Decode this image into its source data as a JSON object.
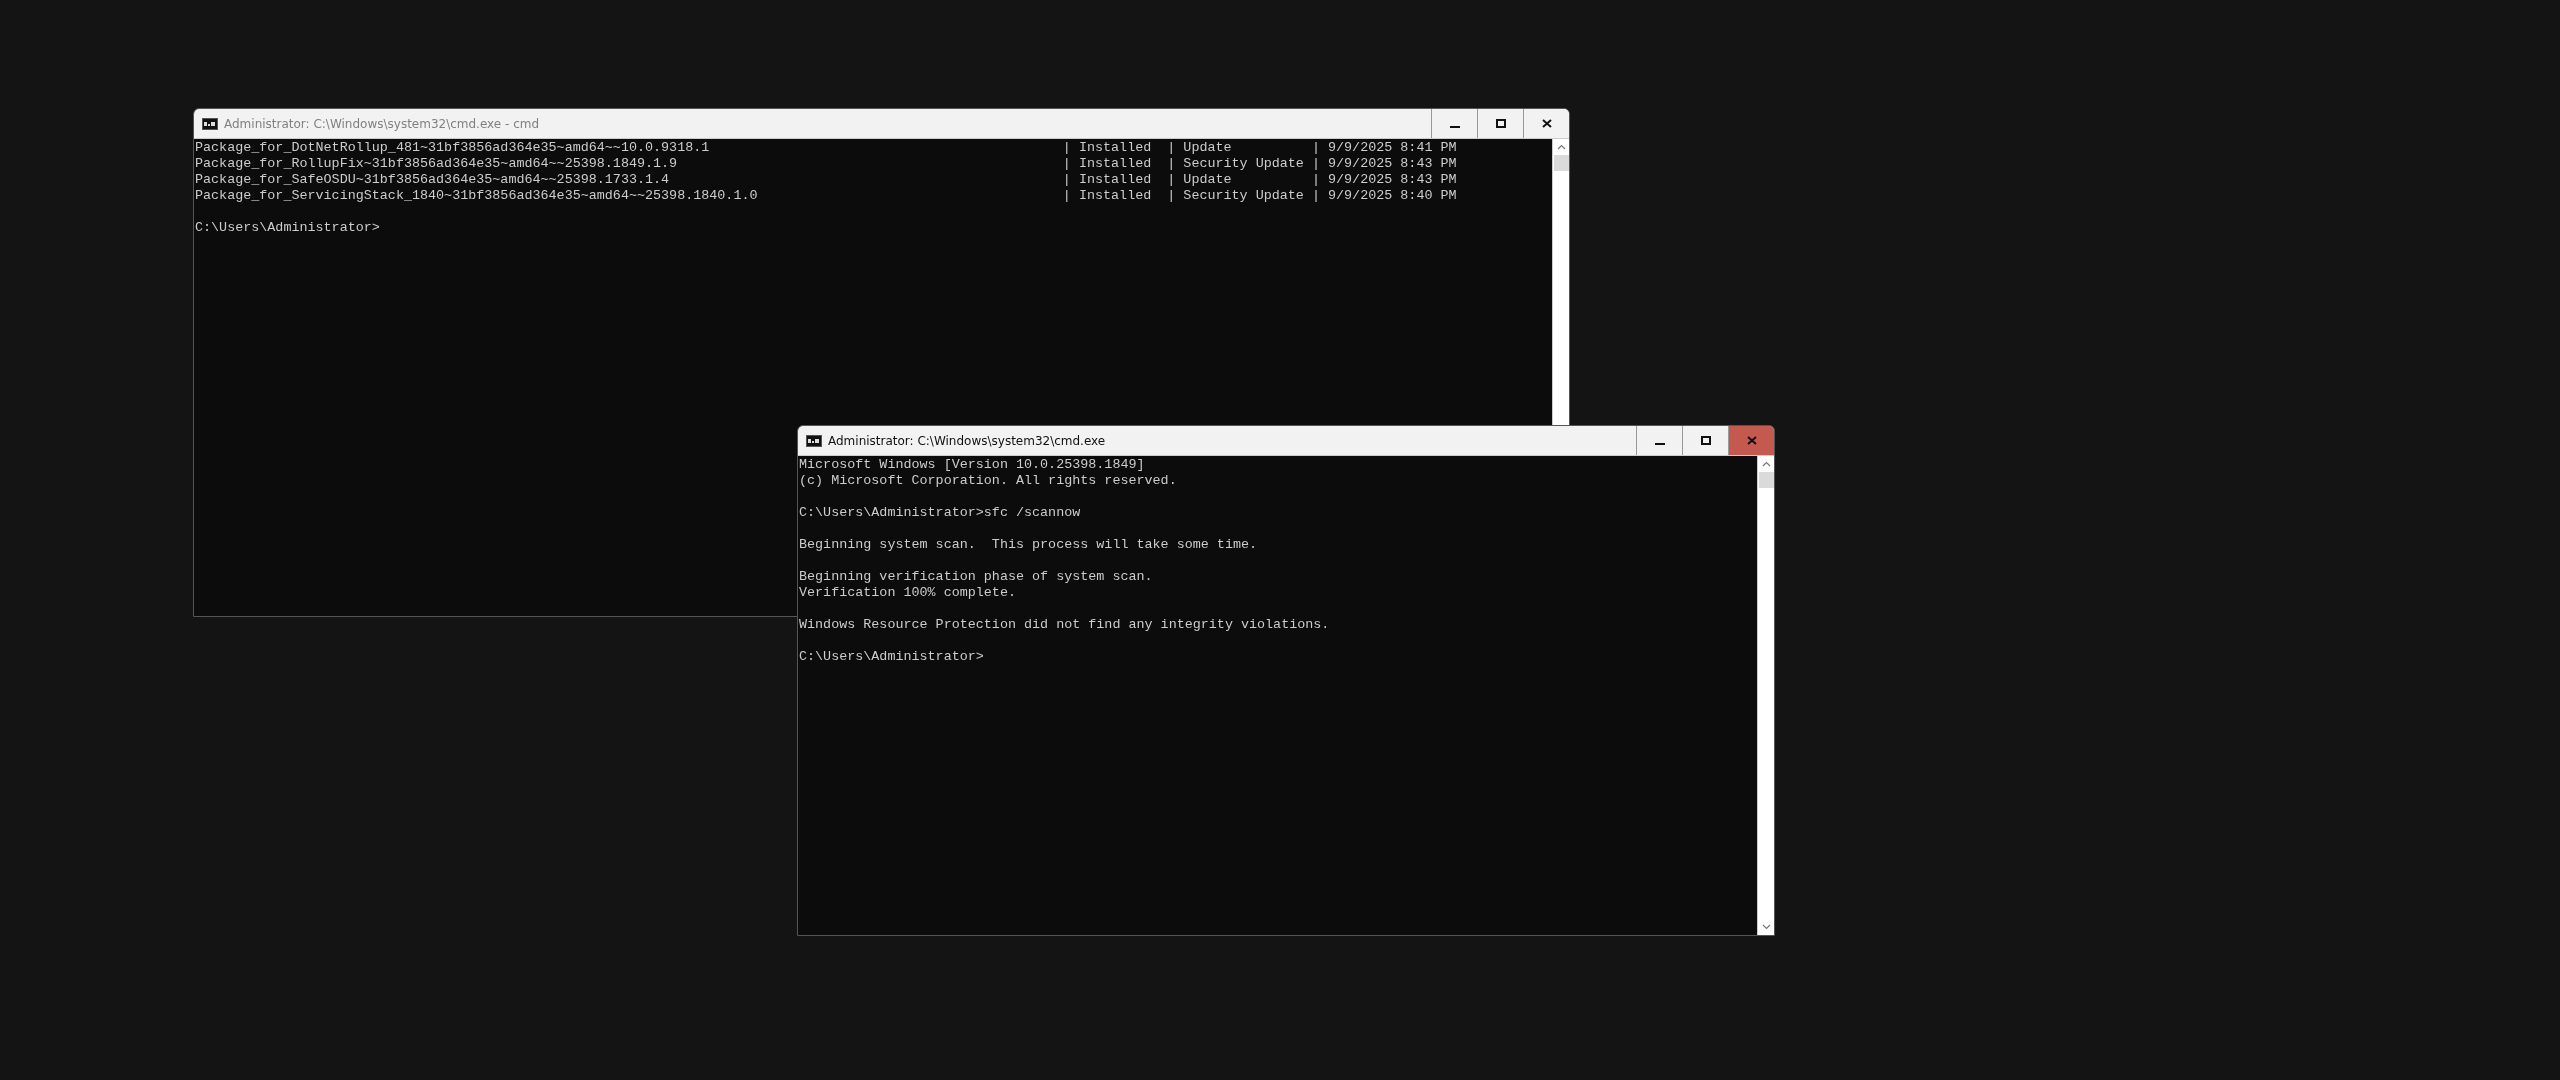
{
  "windows": [
    {
      "title": "Administrator: C:\\Windows\\system32\\cmd.exe - cmd",
      "active": false,
      "close_highlighted": false,
      "kind": "table_output",
      "rows": [
        {
          "package": "Package_for_DotNetRollup_481~31bf3856ad364e35~amd64~~10.0.9318.1",
          "state": "| Installed",
          "type": "| Update",
          "date": "| 9/9/2025 8:41 PM"
        },
        {
          "package": "Package_for_RollupFix~31bf3856ad364e35~amd64~~25398.1849.1.9",
          "state": "| Installed",
          "type": "| Security Update",
          "date": "| 9/9/2025 8:43 PM"
        },
        {
          "package": "Package_for_SafeOSDU~31bf3856ad364e35~amd64~~25398.1733.1.4",
          "state": "| Installed",
          "type": "| Update",
          "date": "| 9/9/2025 8:43 PM"
        },
        {
          "package": "Package_for_ServicingStack_1840~31bf3856ad364e35~amd64~~25398.1840.1.0",
          "state": "| Installed",
          "type": "| Security Update",
          "date": "| 9/9/2025 8:40 PM"
        }
      ],
      "paragraphs": [
        [
          "C:\\Users\\Administrator>"
        ]
      ]
    },
    {
      "title": "Administrator: C:\\Windows\\system32\\cmd.exe",
      "active": true,
      "close_highlighted": true,
      "kind": "text_output",
      "paragraphs": [
        [
          "Microsoft Windows [Version 10.0.25398.1849]",
          "(c) Microsoft Corporation. All rights reserved."
        ],
        [
          "C:\\Users\\Administrator>sfc /scannow"
        ],
        [
          "Beginning system scan.  This process will take some time."
        ],
        [
          "Beginning verification phase of system scan.",
          "Verification 100% complete."
        ],
        [
          "Windows Resource Protection did not find any integrity violations."
        ],
        [
          "C:\\Users\\Administrator>"
        ]
      ]
    }
  ]
}
